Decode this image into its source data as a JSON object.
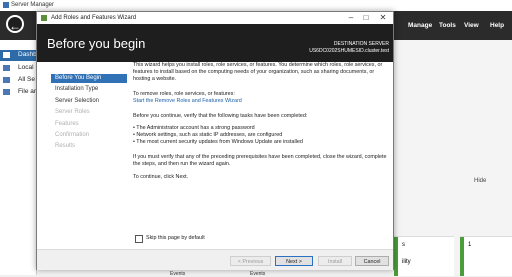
{
  "server_manager": {
    "title": "Server Manager",
    "menu": [
      "Manage",
      "Tools",
      "View",
      "Help"
    ],
    "sidebar": [
      {
        "label": "Dashb",
        "active": true
      },
      {
        "label": "Local",
        "active": false
      },
      {
        "label": "All Se",
        "active": false
      },
      {
        "label": "File ar",
        "active": false
      }
    ],
    "hide": "Hide",
    "tile_label": "s",
    "tile_sub": "ility",
    "tile_num": "1",
    "events": [
      "Events",
      "Events"
    ]
  },
  "wizard": {
    "window_title": "Add Roles and Features Wizard",
    "heading": "Before you begin",
    "destination_label": "DESTINATION SERVER",
    "destination_server": "US6DC0202SHUMESID.cluster.test",
    "steps": [
      {
        "label": "Before You Begin",
        "state": "active"
      },
      {
        "label": "Installation Type",
        "state": "normal"
      },
      {
        "label": "Server Selection",
        "state": "normal"
      },
      {
        "label": "Server Roles",
        "state": "dim"
      },
      {
        "label": "Features",
        "state": "dim"
      },
      {
        "label": "Confirmation",
        "state": "dim"
      },
      {
        "label": "Results",
        "state": "dim"
      }
    ],
    "intro": "This wizard helps you install roles, role services, or features. You determine which roles, role services, or features to install based on the computing needs of your organization, such as sharing documents, or hosting a website.",
    "remove_text": "To remove roles, role services, or features:",
    "remove_link": "Start the Remove Roles and Features Wizard",
    "verify_text": "Before you continue, verify that the following tasks have been completed:",
    "bullets": [
      "The Administrator account has a strong password",
      "Network settings, such as static IP addresses, are configured",
      "The most current security updates from Windows Update are installed"
    ],
    "prereq_text": "If you must verify that any of the preceding prerequisites have been completed, close the wizard, complete the steps, and then run the wizard again.",
    "continue_text": "To continue, click Next.",
    "skip_label": "Skip this page by default",
    "buttons": {
      "previous": "< Previous",
      "next": "Next >",
      "install": "Install",
      "cancel": "Cancel"
    }
  }
}
